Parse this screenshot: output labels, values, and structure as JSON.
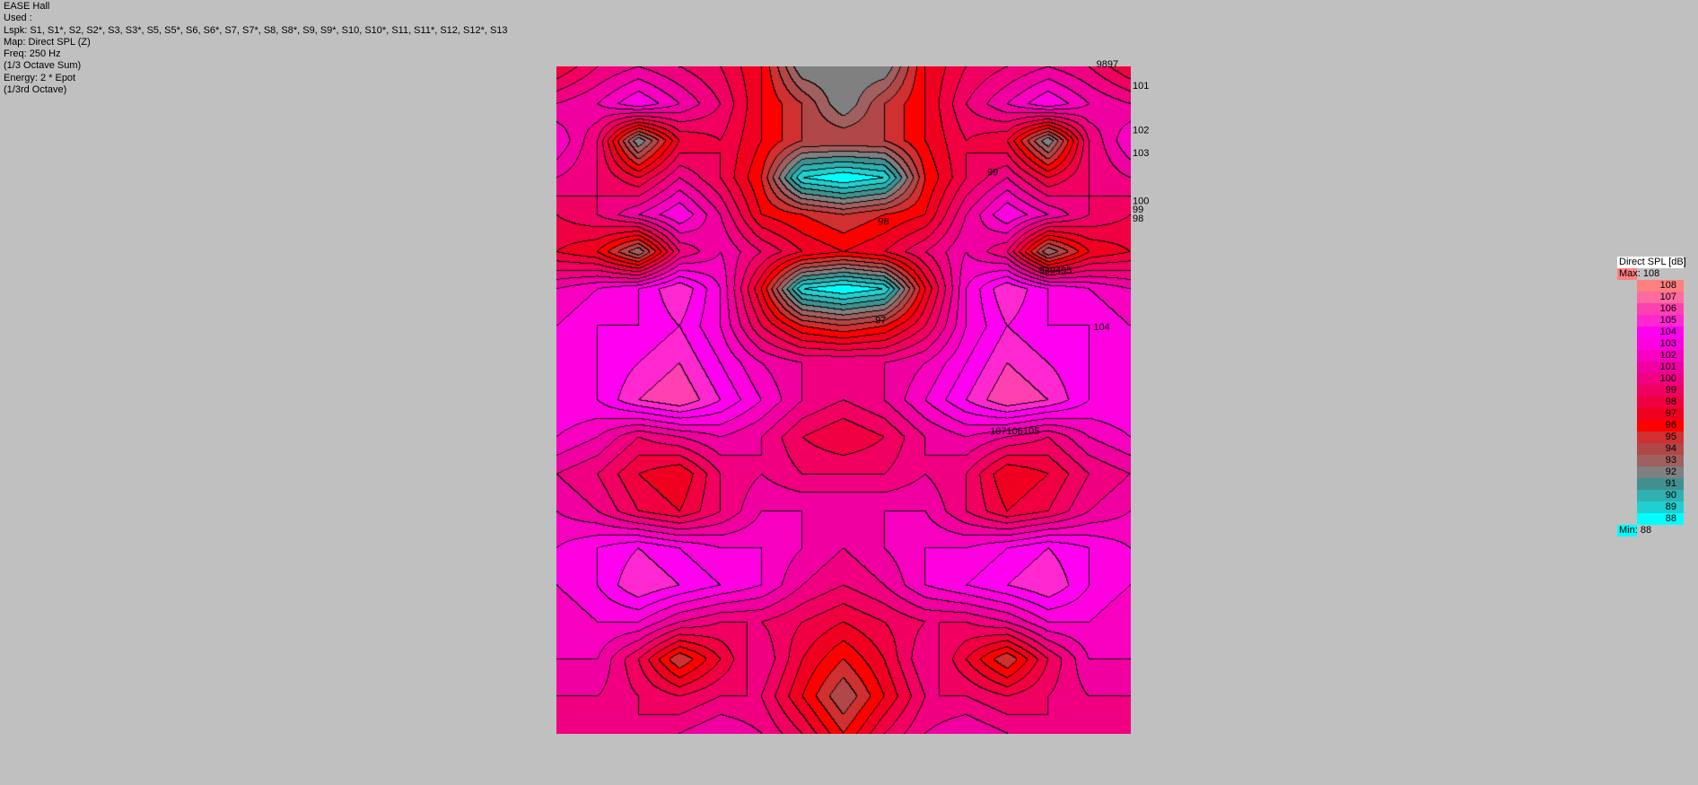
{
  "info": {
    "title": "EASE Hall",
    "used": "Used :",
    "lspk": "Lspk: S1, S1*, S2, S2*, S3, S3*, S5, S5*, S6, S6*, S7, S7*, S8, S8*, S9, S9*, S10, S10*, S11, S11*, S12, S12*, S13",
    "map": "Map: Direct SPL (Z)",
    "freq": "Freq: 250 Hz",
    "octave_sum": "(1/3 Octave Sum)",
    "energy": "Energy: 2 * Epot",
    "band": "(1/3rd Octave)"
  },
  "chart_data": {
    "type": "heatmap",
    "title": "Direct SPL [dB]",
    "max_label": "Max:",
    "max": "108",
    "min_label": "Min:",
    "min": "88",
    "levels": [
      108,
      107,
      106,
      105,
      104,
      103,
      102,
      101,
      100,
      99,
      98,
      97,
      96,
      95,
      94,
      93,
      92,
      91,
      90,
      89,
      88
    ],
    "level_colors": [
      "#ff8080",
      "#ff6aa0",
      "#ff40b0",
      "#ff28d0",
      "#ff00f0",
      "#ff00e0",
      "#f800c0",
      "#f000a0",
      "#f00080",
      "#f00060",
      "#f00040",
      "#f00020",
      "#ff0000",
      "#d03030",
      "#b04848",
      "#a06060",
      "#808080",
      "#409090",
      "#30b0b0",
      "#20d0d0",
      "#00ffff"
    ],
    "edge_labels": [
      {
        "text": "9897",
        "x": 0.94,
        "y": -0.004
      },
      {
        "text": "101",
        "x": 1.0,
        "y": 0.028
      },
      {
        "text": "102",
        "x": 1.0,
        "y": 0.095
      },
      {
        "text": "103",
        "x": 1.0,
        "y": 0.129
      },
      {
        "text": "100",
        "x": 1.0,
        "y": 0.201
      },
      {
        "text": "99",
        "x": 1.0,
        "y": 0.214
      },
      {
        "text": "98",
        "x": 1.0,
        "y": 0.227
      }
    ],
    "interior_labels": [
      {
        "text": "99",
        "x": 0.75,
        "y": 0.158
      },
      {
        "text": "98",
        "x": 0.56,
        "y": 0.232
      },
      {
        "text": "97",
        "x": 0.555,
        "y": 0.38
      },
      {
        "text": "939495",
        "x": 0.84,
        "y": 0.305
      },
      {
        "text": "104",
        "x": 0.935,
        "y": 0.39
      },
      {
        "text": "107106105",
        "x": 0.755,
        "y": 0.546
      }
    ],
    "grid": [
      [
        98,
        100,
        101,
        100,
        99,
        97,
        92,
        92,
        92,
        97,
        99,
        100,
        101,
        100,
        98
      ],
      [
        101,
        102,
        104,
        102,
        100,
        97,
        95,
        92,
        95,
        97,
        100,
        102,
        104,
        102,
        101
      ],
      [
        103,
        100,
        92,
        98,
        99,
        97,
        95,
        95,
        95,
        97,
        99,
        98,
        92,
        100,
        103
      ],
      [
        101,
        100,
        98,
        101,
        99,
        96,
        89,
        88,
        89,
        96,
        99,
        101,
        98,
        100,
        101
      ],
      [
        99,
        100,
        102,
        104,
        101,
        97,
        96,
        95,
        96,
        97,
        101,
        104,
        102,
        100,
        99
      ],
      [
        98,
        97,
        93,
        100,
        102,
        100,
        98,
        97,
        98,
        100,
        102,
        100,
        93,
        97,
        98
      ],
      [
        102,
        103,
        104,
        106,
        103,
        97,
        89,
        88,
        89,
        97,
        103,
        106,
        104,
        103,
        102
      ],
      [
        103,
        104,
        104,
        105,
        103,
        99,
        96,
        95,
        96,
        99,
        103,
        105,
        104,
        104,
        103
      ],
      [
        103,
        104,
        105,
        106,
        104,
        102,
        101,
        101,
        101,
        102,
        104,
        106,
        105,
        104,
        103
      ],
      [
        104,
        104,
        106,
        107,
        105,
        103,
        101,
        100,
        101,
        103,
        105,
        107,
        106,
        104,
        104
      ],
      [
        103,
        102,
        100,
        101,
        102,
        101,
        99,
        98,
        99,
        101,
        102,
        101,
        100,
        102,
        103
      ],
      [
        101,
        100,
        98,
        97,
        100,
        101,
        100,
        100,
        100,
        101,
        100,
        97,
        98,
        100,
        101
      ],
      [
        102,
        101,
        99,
        98,
        100,
        102,
        102,
        102,
        102,
        102,
        100,
        98,
        99,
        101,
        102
      ],
      [
        103,
        104,
        105,
        104,
        103,
        103,
        102,
        101,
        102,
        103,
        103,
        104,
        105,
        104,
        103
      ],
      [
        103,
        104,
        106,
        105,
        104,
        103,
        101,
        100,
        101,
        103,
        104,
        105,
        106,
        104,
        103
      ],
      [
        102,
        103,
        103,
        101,
        100,
        100,
        99,
        98,
        99,
        100,
        100,
        101,
        103,
        103,
        102
      ],
      [
        102,
        102,
        99,
        95,
        98,
        101,
        98,
        96,
        98,
        101,
        98,
        95,
        99,
        102,
        102
      ],
      [
        101,
        101,
        100,
        99,
        100,
        100,
        97,
        94,
        97,
        100,
        100,
        99,
        100,
        101,
        101
      ],
      [
        100,
        100,
        100,
        101,
        102,
        101,
        99,
        96,
        99,
        101,
        102,
        101,
        100,
        100,
        100
      ]
    ]
  }
}
